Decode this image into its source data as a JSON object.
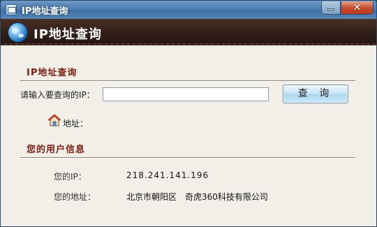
{
  "window": {
    "title": "IP地址查询",
    "minimize_glyph": "—",
    "close_glyph": "✕"
  },
  "banner": {
    "title": "IP地址查询"
  },
  "query": {
    "section_title": "IP地址查询",
    "ip_label": "请输入要查询的IP：",
    "ip_value": "",
    "ip_placeholder": "",
    "button_label": "查 询",
    "address_label": "地址："
  },
  "user_info": {
    "section_title": "您的用户信息",
    "ip_label": "您的IP：",
    "ip_value": "218.241.141.196",
    "address_label": "您的地址：",
    "address_region": "北京市朝阳区",
    "address_isp": "奇虎360科技有限公司"
  },
  "icons": {
    "app": "app-window-icon",
    "banner": "globe-icon",
    "address": "house-icon"
  }
}
